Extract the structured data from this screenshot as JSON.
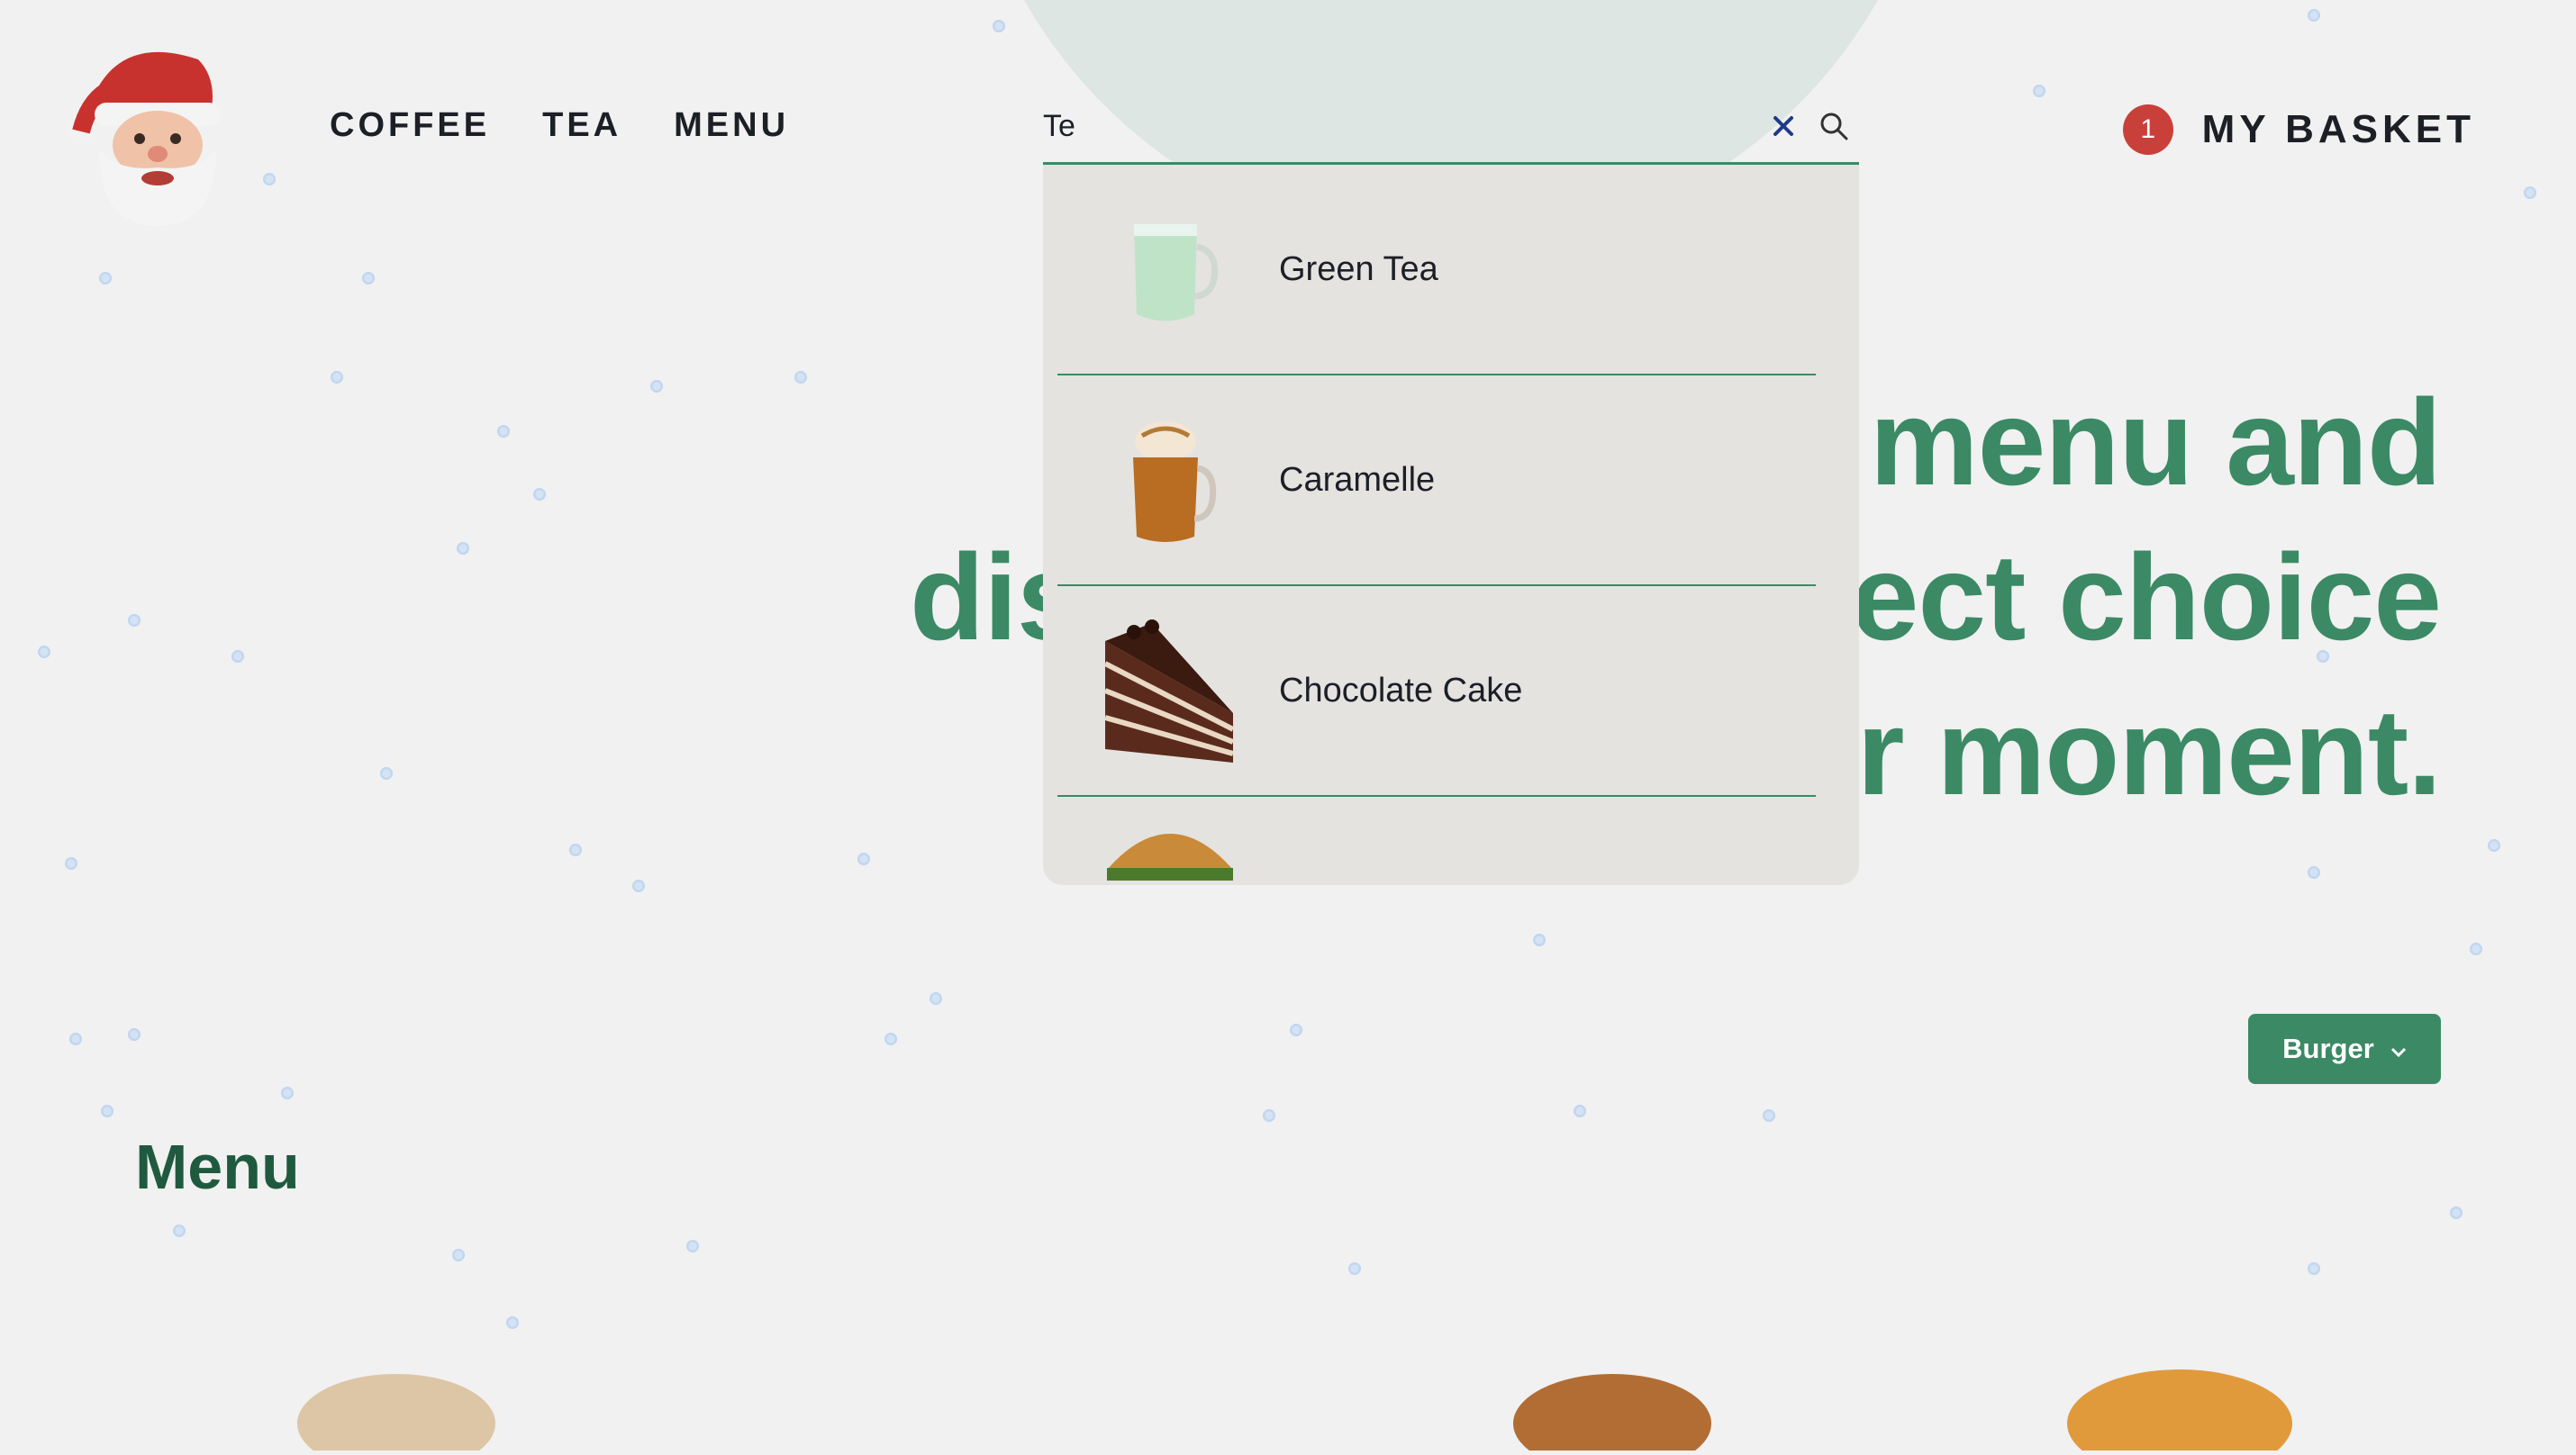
{
  "nav": {
    "items": [
      "COFFEE",
      "TEA",
      "MENU"
    ]
  },
  "search": {
    "value": "Te",
    "clear_icon": "close-icon",
    "search_icon": "search-icon"
  },
  "dropdown": {
    "items": [
      {
        "label": "Green Tea",
        "icon": "green-tea-mug-icon"
      },
      {
        "label": "Caramelle",
        "icon": "caramel-drink-icon"
      },
      {
        "label": "Chocolate Cake",
        "icon": "chocolate-cake-icon"
      },
      {
        "label": "",
        "icon": "burger-icon"
      }
    ]
  },
  "hero": {
    "line1": "menu and",
    "line2_left": "dis",
    "line2_right": "ect choice",
    "line3": "r moment."
  },
  "basket": {
    "count": "1",
    "label": "MY BASKET"
  },
  "filter": {
    "label": "Burger"
  },
  "menu": {
    "title": "Menu"
  },
  "colors": {
    "accent": "#3b8a65",
    "badge": "#c9403a",
    "background": "#f1f1f1",
    "dropdown": "#e4e3e0"
  }
}
